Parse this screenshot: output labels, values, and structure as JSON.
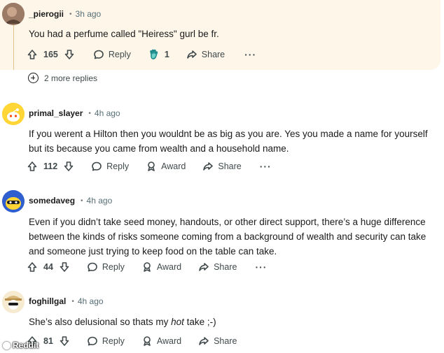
{
  "comments": [
    {
      "username": "_pierogii",
      "time": "3h ago",
      "body": "You had a perfume called \"Heiress\" gurl be fr.",
      "upvotes": "165",
      "reply_label": "Reply",
      "award_count": "1",
      "share_label": "Share",
      "more_replies": "2 more replies",
      "highlight_color": "#fdf6e9"
    },
    {
      "username": "primal_slayer",
      "time": "4h ago",
      "body": "If you werent a Hilton then you wouldnt be as big as you are. Yes you made a name for yourself but its because you came from wealth and a household name.",
      "upvotes": "112",
      "reply_label": "Reply",
      "award_label": "Award",
      "share_label": "Share"
    },
    {
      "username": "somedaveg",
      "time": "4h ago",
      "body": "Even if you didn’t take seed money, handouts, or other direct support, there’s a huge difference between the kinds of risks someone coming from a background of wealth and security can take and someone just trying to keep food on the table can take.",
      "upvotes": "44",
      "reply_label": "Reply",
      "award_label": "Award",
      "share_label": "Share"
    },
    {
      "username": "foghillgal",
      "time": "4h ago",
      "body_before": "She’s also delusional so thats my ",
      "body_italic": "hot",
      "body_after": " take ;-)",
      "upvotes": "81",
      "reply_label": "Reply",
      "award_label": "Award",
      "share_label": "Share"
    }
  ],
  "separator": "•",
  "more_label": "···",
  "watermark": "Reddit"
}
